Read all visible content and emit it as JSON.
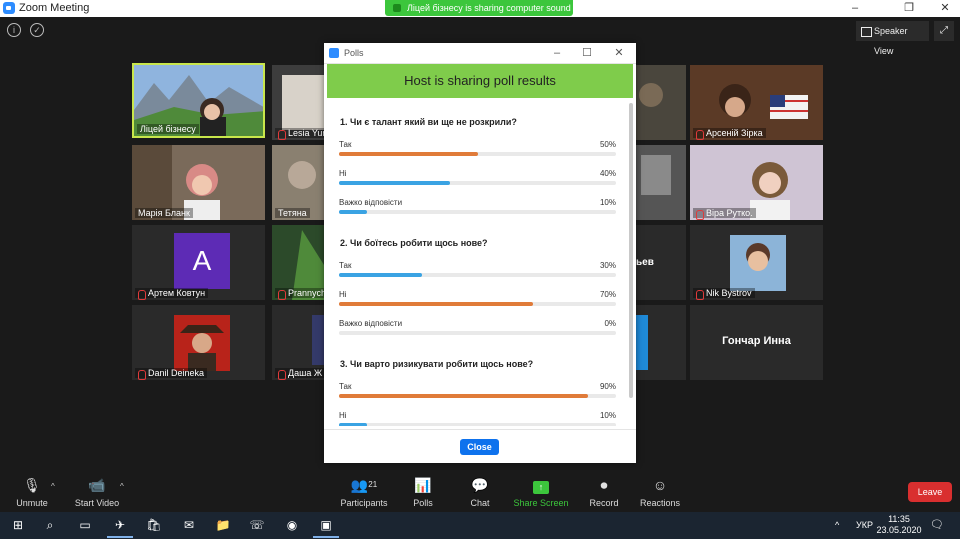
{
  "window": {
    "title": "Zoom Meeting",
    "controls": [
      "–",
      "❐",
      "✕"
    ]
  },
  "share_banner": {
    "text": "Ліцей бізнесу is sharing computer sound"
  },
  "view": {
    "speaker_view_label": "Speaker View",
    "fullscreen_icon": "fullscreen-icon"
  },
  "participants_grid": [
    {
      "name": "Ліцей бізнесу",
      "muted": false,
      "active": true
    },
    {
      "name": "Lesia Yur",
      "muted": true
    },
    {
      "name": "Арсеній Зірка",
      "muted": true
    },
    {
      "name": "Марія Бланк",
      "muted": false
    },
    {
      "name": "Тетяна",
      "muted": false
    },
    {
      "name": "Віра Рутко.",
      "muted": true
    },
    {
      "name": "Артем Ковтун",
      "muted": true,
      "avatar_letter": "A"
    },
    {
      "name": "Prannych",
      "muted": true
    },
    {
      "name": "ьев",
      "muted": false
    },
    {
      "name": "Nik Bystrov",
      "muted": true
    },
    {
      "name": "Danil Deineka",
      "muted": true
    },
    {
      "name": "Даша Ж",
      "muted": true
    },
    {
      "name": "Гончар Инна",
      "muted": true
    }
  ],
  "poll": {
    "window_title": "Polls",
    "header": "Host is sharing poll results",
    "questions": [
      {
        "question": "1. Чи є талант який ви ще не розкрили?",
        "options": [
          {
            "label": "Так",
            "percent_text": "50%",
            "value": 50,
            "color": "#e07b39"
          },
          {
            "label": "Ні",
            "percent_text": "40%",
            "value": 40,
            "color": "#3aa3e3"
          },
          {
            "label": "Важко відповісти",
            "percent_text": "10%",
            "value": 10,
            "color": "#3aa3e3"
          }
        ]
      },
      {
        "question": "2. Чи боїтесь робити щось нове?",
        "options": [
          {
            "label": "Так",
            "percent_text": "30%",
            "value": 30,
            "color": "#3aa3e3"
          },
          {
            "label": "Ні",
            "percent_text": "70%",
            "value": 70,
            "color": "#e07b39"
          },
          {
            "label": "Важко відповісти",
            "percent_text": "0%",
            "value": 0,
            "color": "#3aa3e3"
          }
        ]
      },
      {
        "question": "3. Чи варто ризикувати робити щось нове?",
        "options": [
          {
            "label": "Так",
            "percent_text": "90%",
            "value": 90,
            "color": "#e07b39"
          },
          {
            "label": "Ні",
            "percent_text": "10%",
            "value": 10,
            "color": "#3aa3e3"
          }
        ]
      }
    ],
    "close_label": "Close"
  },
  "toolbar": {
    "unmute_label": "Unmute",
    "start_video_label": "Start Video",
    "participants_label": "Participants",
    "participants_count": "21",
    "polls_label": "Polls",
    "chat_label": "Chat",
    "share_screen_label": "Share Screen",
    "record_label": "Record",
    "reactions_label": "Reactions",
    "leave_label": "Leave"
  },
  "taskbar": {
    "language": "УКР",
    "time": "11:35",
    "date": "23.05.2020"
  }
}
